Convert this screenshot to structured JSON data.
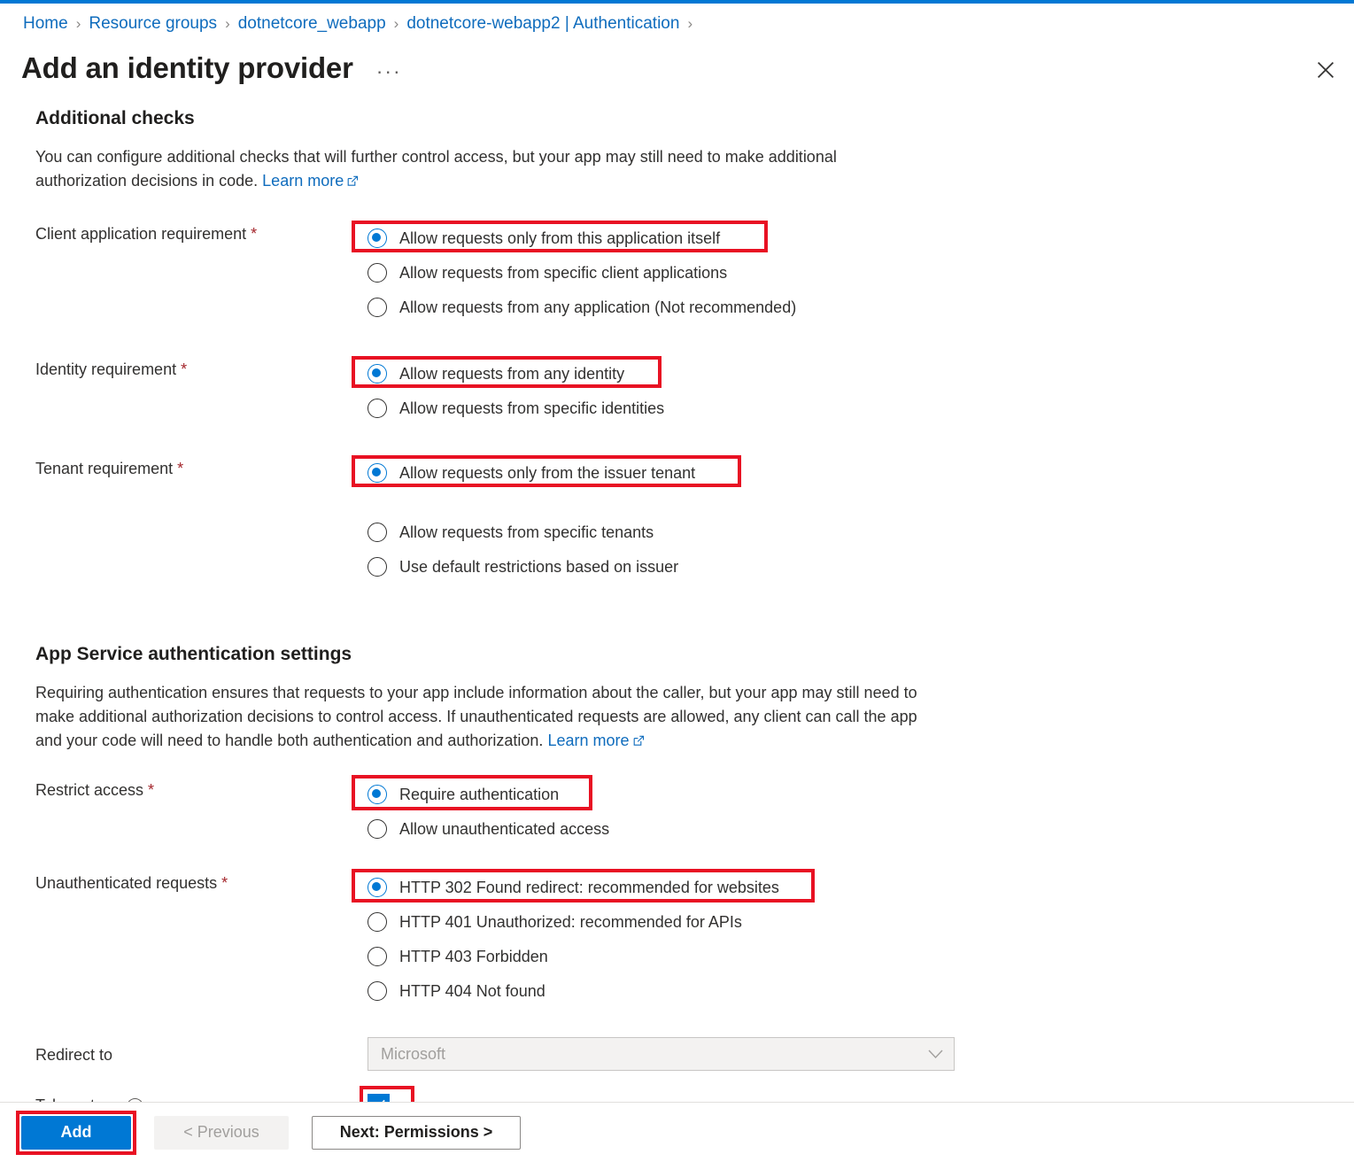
{
  "breadcrumb": {
    "items": [
      "Home",
      "Resource groups",
      "dotnetcore_webapp",
      "dotnetcore-webapp2 | Authentication"
    ],
    "separator": "›"
  },
  "header": {
    "title": "Add an identity provider",
    "ellipsis": "···",
    "close_label": "Close"
  },
  "additional_checks": {
    "heading": "Additional checks",
    "description_part1": "You can configure additional checks that will further control access, but your app may still need to make additional authorization decisions in code.",
    "learn_more": "Learn more",
    "client_application_requirement": {
      "label": "Client application requirement",
      "required": "*",
      "options": [
        "Allow requests only from this application itself",
        "Allow requests from specific client applications",
        "Allow requests from any application (Not recommended)"
      ],
      "selected_index": 0
    },
    "identity_requirement": {
      "label": "Identity requirement",
      "required": "*",
      "options": [
        "Allow requests from any identity",
        "Allow requests from specific identities"
      ],
      "selected_index": 0
    },
    "tenant_requirement": {
      "label": "Tenant requirement",
      "required": "*",
      "options": [
        "Allow requests only from the issuer tenant",
        "Allow requests from specific tenants",
        "Use default restrictions based on issuer"
      ],
      "selected_index": 0
    }
  },
  "app_service_auth": {
    "heading": "App Service authentication settings",
    "description_part1": "Requiring authentication ensures that requests to your app include information about the caller, but your app may still need to make additional authorization decisions to control access. If unauthenticated requests are allowed, any client can call the app and your code will need to handle both authentication and authorization.",
    "learn_more": "Learn more",
    "restrict_access": {
      "label": "Restrict access",
      "required": "*",
      "options": [
        "Require authentication",
        "Allow unauthenticated access"
      ],
      "selected_index": 0
    },
    "unauthenticated_requests": {
      "label": "Unauthenticated requests",
      "required": "*",
      "options": [
        "HTTP 302 Found redirect: recommended for websites",
        "HTTP 401 Unauthorized: recommended for APIs",
        "HTTP 403 Forbidden",
        "HTTP 404 Not found"
      ],
      "selected_index": 0
    },
    "redirect_to": {
      "label": "Redirect to",
      "value": "Microsoft",
      "disabled": true
    },
    "token_store": {
      "label": "Token store",
      "checked": true,
      "info_glyph": "i"
    }
  },
  "footer": {
    "add_label": "Add",
    "previous_label": "< Previous",
    "next_label": "Next: Permissions >"
  },
  "colors": {
    "accent": "#0078d4",
    "link": "#0f6cbd",
    "highlight": "#e81123",
    "required_star": "#a4262c"
  }
}
